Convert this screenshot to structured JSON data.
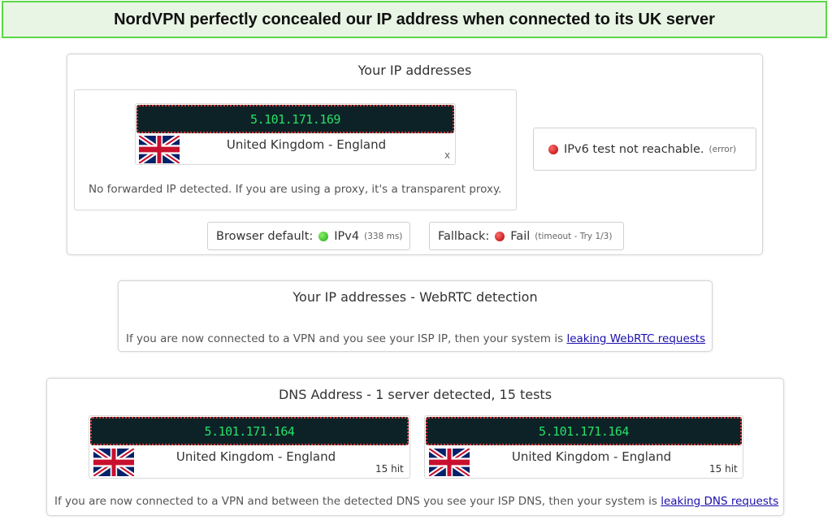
{
  "banner": "NordVPN perfectly concealed our IP address when connected to its UK server",
  "ip_panel": {
    "title": "Your IP addresses",
    "ipv4": {
      "address": "5.101.171.169",
      "location": "United Kingdom - England",
      "close": "x"
    },
    "forwarded_note": "No forwarded IP detected. If you are using a proxy, it's a transparent proxy.",
    "ipv6": {
      "text": "IPv6 test not reachable.",
      "detail": "(error)"
    },
    "browser_default": {
      "label": "Browser default:",
      "value": "IPv4",
      "detail": "(338 ms)"
    },
    "fallback": {
      "label": "Fallback:",
      "value": "Fail",
      "detail": "(timeout - Try 1/3)"
    }
  },
  "webrtc_panel": {
    "title": "Your IP addresses - WebRTC detection",
    "note_prefix": "If you are now connected to a VPN and you see your ISP IP, then your system is ",
    "note_link": "leaking WebRTC requests"
  },
  "dns_panel": {
    "title": "DNS Address - 1 server detected, 15 tests",
    "servers": [
      {
        "address": "5.101.171.164",
        "location": "United Kingdom - England",
        "hits": "15 hit"
      },
      {
        "address": "5.101.171.164",
        "location": "United Kingdom - England",
        "hits": "15 hit"
      }
    ],
    "note_prefix": "If you are now connected to a VPN and between the detected DNS you see your ISP DNS, then your system is ",
    "note_link": "leaking DNS requests"
  },
  "colors": {
    "banner_border": "#5cd64a",
    "ip_text": "#27e06a",
    "ip_bar_bg": "#0d2226",
    "status_green": "#1faa16",
    "status_red": "#b10000",
    "link": "#1a0dab"
  },
  "icons": [
    "uk-flag-icon",
    "green-status-dot-icon",
    "red-status-dot-icon"
  ]
}
